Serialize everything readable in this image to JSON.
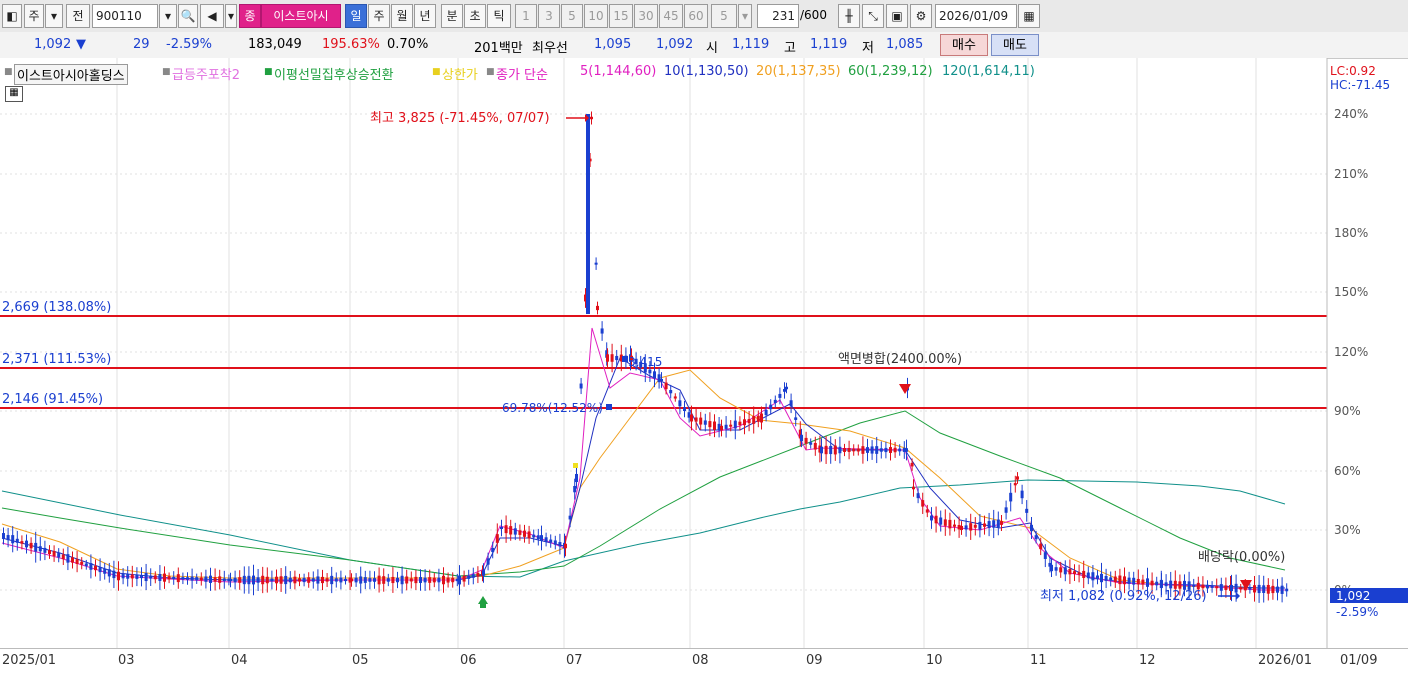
{
  "toolbar": {
    "market_label": "주",
    "prev_label": "전",
    "code": "900110",
    "stock_tag": "종",
    "stock_name": "이스트아시",
    "periods": [
      "일",
      "주",
      "월",
      "년",
      "분",
      "초",
      "틱"
    ],
    "active_period": "일",
    "minutes": [
      "1",
      "3",
      "5",
      "10",
      "15",
      "30",
      "45",
      "60"
    ],
    "custom_minute": "5",
    "count": "231",
    "count_total": "/600",
    "date": "2026/01/09"
  },
  "quote": {
    "price": "1,092",
    "change": "29",
    "change_pct": "-2.59%",
    "volume": "183,049",
    "volume_ratio": "195.63%",
    "turnover": "0.70%",
    "amount": "201백만",
    "bid_label": "최우선",
    "ask_price": "1,095",
    "bid_price": "1,092",
    "open_label": "시",
    "open": "1,119",
    "high_label": "고",
    "high": "1,119",
    "low_label": "저",
    "low": "1,085",
    "buy_label": "매수",
    "sell_label": "매도"
  },
  "legend": {
    "name": "이스트아시아홀딩스",
    "ind1": "급등주포착2",
    "ind2": "이평선밀집후상승전환",
    "ind3": "상한가",
    "ma_title": "종가 단순",
    "ma5": "5(1,144,60)",
    "ma10": "10(1,130,50)",
    "ma20": "20(1,137,35)",
    "ma60": "60(1,239,12)",
    "ma120": "120(1,614,11)",
    "lc": "LC:0.92",
    "hc": "HC:-71.45"
  },
  "annotations": {
    "high": "최고 3,825 (-71.45%, 07/07)",
    "low": "최저 1,082 (0.92%, 12/26)",
    "line1": "2,669 (138.08%)",
    "line2": "2,371 (111.53%)",
    "line3": "2,146 (91.45%)",
    "merge": "액면병합(2400.00%)",
    "dividend": "배당락(0.00%)",
    "mark_a": "3,415",
    "mark_b": "69.78%(12.52%)",
    "cur_price": "1,092",
    "cur_pct": "-2.59%"
  },
  "colors": {
    "up": "#e0101a",
    "down": "#1a3fd0",
    "ma5": "#e020c0",
    "ma10": "#2030c0",
    "ma20": "#f0a020",
    "ma60": "#20a040",
    "ma120": "#10908a"
  },
  "chart_data": {
    "type": "candlestick",
    "y_axis": [
      "240%",
      "210%",
      "180%",
      "150%",
      "120%",
      "90%",
      "60%",
      "30%",
      "0%"
    ],
    "x_axis": [
      "2025/01",
      "03",
      "04",
      "05",
      "06",
      "07",
      "08",
      "09",
      "10",
      "11",
      "12",
      "2026/01",
      "01/09"
    ],
    "horizontal_lines": [
      138.08,
      111.53,
      91.45
    ]
  }
}
